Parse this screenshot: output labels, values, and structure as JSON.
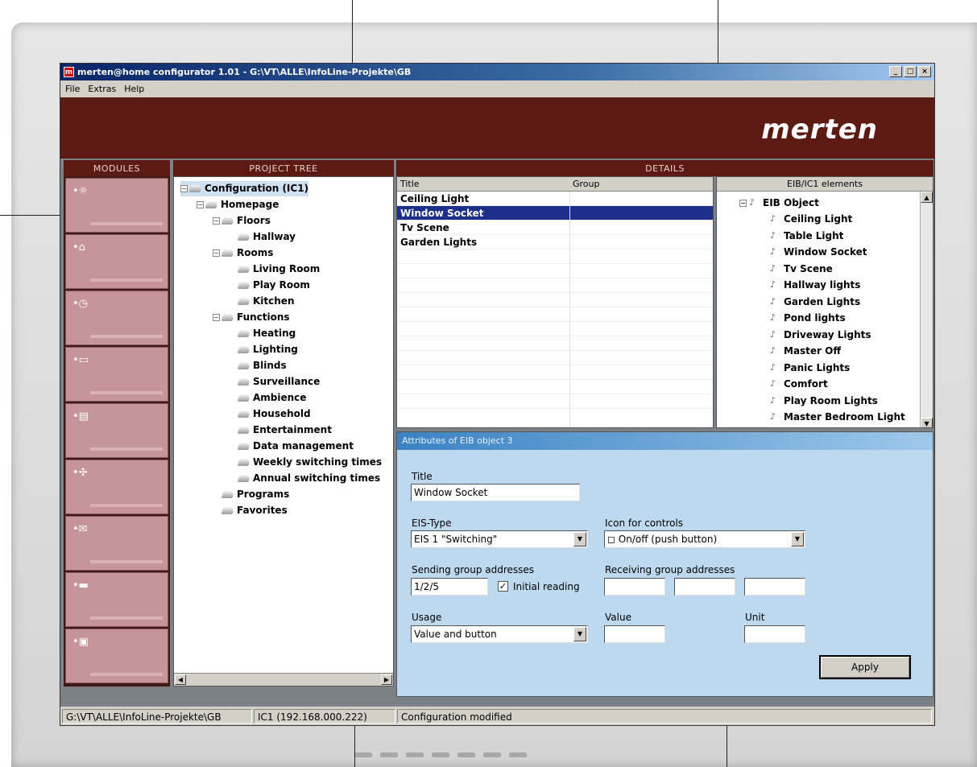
{
  "window": {
    "title": "merten@home configurator 1.01 - G:\\VT\\ALLE\\InfoLine-Projekte\\GB",
    "controls": [
      "_",
      "□",
      "×"
    ]
  },
  "menu": [
    "File",
    "Extras",
    "Help"
  ],
  "brand": "merten",
  "panels": {
    "modules": "MODULES",
    "project_tree": "PROJECT TREE",
    "details": "DETAILS"
  },
  "modules": [
    "bulb-icon",
    "house-icon",
    "clock-icon",
    "book-icon",
    "notebook-icon",
    "fan-icon",
    "mail-icon",
    "screen-icon",
    "monitor-icon"
  ],
  "tree": [
    {
      "label": "Configuration (IC1)",
      "level": 0,
      "toggle": "−"
    },
    {
      "label": "Homepage",
      "level": 1,
      "toggle": "−"
    },
    {
      "label": "Floors",
      "level": 2,
      "toggle": "−"
    },
    {
      "label": "Hallway",
      "level": 3,
      "toggle": ""
    },
    {
      "label": "Rooms",
      "level": 2,
      "toggle": "−"
    },
    {
      "label": "Living Room",
      "level": 3,
      "toggle": ""
    },
    {
      "label": "Play Room",
      "level": 3,
      "toggle": ""
    },
    {
      "label": "Kitchen",
      "level": 3,
      "toggle": ""
    },
    {
      "label": "Functions",
      "level": 2,
      "toggle": "−"
    },
    {
      "label": "Heating",
      "level": 3,
      "toggle": ""
    },
    {
      "label": "Lighting",
      "level": 3,
      "toggle": ""
    },
    {
      "label": "Blinds",
      "level": 3,
      "toggle": ""
    },
    {
      "label": "Surveillance",
      "level": 3,
      "toggle": ""
    },
    {
      "label": "Ambience",
      "level": 3,
      "toggle": ""
    },
    {
      "label": "Household",
      "level": 3,
      "toggle": ""
    },
    {
      "label": "Entertainment",
      "level": 3,
      "toggle": ""
    },
    {
      "label": "Data management",
      "level": 3,
      "toggle": ""
    },
    {
      "label": "Weekly switching times",
      "level": 3,
      "toggle": ""
    },
    {
      "label": "Annual switching times",
      "level": 3,
      "toggle": ""
    },
    {
      "label": "Programs",
      "level": 2,
      "toggle": ""
    },
    {
      "label": "Favorites",
      "level": 2,
      "toggle": ""
    }
  ],
  "details": {
    "columns": [
      "Title",
      "Group"
    ],
    "rows": [
      "Ceiling Light",
      "Window Socket",
      "Tv Scene",
      "Garden Lights"
    ],
    "selected_row": "Window Socket"
  },
  "eib": {
    "header": "EIB/IC1 elements",
    "root": "EIB Object",
    "items": [
      "Ceiling Light",
      "Table Light",
      "Window Socket",
      "Tv Scene",
      "Hallway lights",
      "Garden Lights",
      "Pond lights",
      "Driveway Lights",
      "Master Off",
      "Panic Lights",
      "Comfort",
      "Play Room Lights",
      "Master Bedroom Light"
    ]
  },
  "attributes": {
    "header": "Attributes of EIB object 3",
    "title_label": "Title",
    "title_value": "Window Socket",
    "eis_label": "EIS-Type",
    "eis_value": "EIS 1 \"Switching\"",
    "icon_label": "Icon for controls",
    "icon_value": "On/off (push button)",
    "sending_label": "Sending group addresses",
    "sending_value": "1/2/5",
    "initial_reading_label": "Initial reading",
    "initial_reading_checked": "✓",
    "receiving_label": "Receiving group addresses",
    "usage_label": "Usage",
    "usage_value": "Value and button",
    "value_label": "Value",
    "unit_label": "Unit",
    "apply_label": "Apply"
  },
  "status": {
    "path": "G:\\VT\\ALLE\\InfoLine-Projekte\\GB",
    "connection": "IC1 (192.168.000.222)",
    "message": "Configuration modified"
  }
}
